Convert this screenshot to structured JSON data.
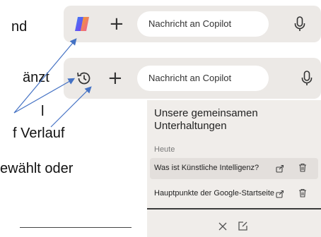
{
  "document": {
    "lines": [
      "nd",
      "änzt",
      "l",
      "f Verlauf",
      "ewählt oder"
    ]
  },
  "copilot_bar_default": {
    "placeholder": "Nachricht an Copilot",
    "logo_icon": "copilot-logo-icon",
    "plus_icon": "+",
    "mic_icon": "microphone-icon"
  },
  "copilot_bar_history": {
    "placeholder": "Nachricht an Copilot",
    "history_icon": "history-icon",
    "plus_icon": "+",
    "mic_icon": "microphone-icon"
  },
  "conversations_panel": {
    "title": "Unsere gemeinsamen Unterhaltungen",
    "section_label": "Heute",
    "items": [
      {
        "title": "Was ist Künstliche Intelligenz?"
      },
      {
        "title": "Hauptpunkte der Google-Startseite"
      }
    ],
    "footer": {
      "close_icon": "×",
      "new_chat_icon": "new-chat-icon"
    }
  },
  "colors": {
    "arrow": "#4472c4",
    "bar_background": "#ece9e6",
    "panel_background": "#f0edea"
  }
}
